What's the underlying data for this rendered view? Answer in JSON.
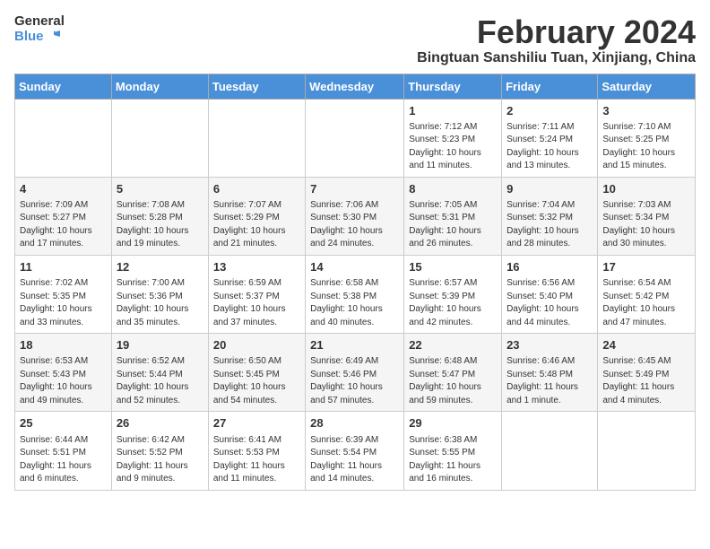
{
  "header": {
    "logo_text_general": "General",
    "logo_text_blue": "Blue",
    "month_year": "February 2024",
    "location": "Bingtuan Sanshiliu Tuan, Xinjiang, China"
  },
  "weekdays": [
    "Sunday",
    "Monday",
    "Tuesday",
    "Wednesday",
    "Thursday",
    "Friday",
    "Saturday"
  ],
  "weeks": [
    [
      {
        "day": "",
        "sunrise": "",
        "sunset": "",
        "daylight": "",
        "empty": true
      },
      {
        "day": "",
        "sunrise": "",
        "sunset": "",
        "daylight": "",
        "empty": true
      },
      {
        "day": "",
        "sunrise": "",
        "sunset": "",
        "daylight": "",
        "empty": true
      },
      {
        "day": "",
        "sunrise": "",
        "sunset": "",
        "daylight": "",
        "empty": true
      },
      {
        "day": "1",
        "sunrise": "Sunrise: 7:12 AM",
        "sunset": "Sunset: 5:23 PM",
        "daylight": "Daylight: 10 hours and 11 minutes.",
        "empty": false
      },
      {
        "day": "2",
        "sunrise": "Sunrise: 7:11 AM",
        "sunset": "Sunset: 5:24 PM",
        "daylight": "Daylight: 10 hours and 13 minutes.",
        "empty": false
      },
      {
        "day": "3",
        "sunrise": "Sunrise: 7:10 AM",
        "sunset": "Sunset: 5:25 PM",
        "daylight": "Daylight: 10 hours and 15 minutes.",
        "empty": false
      }
    ],
    [
      {
        "day": "4",
        "sunrise": "Sunrise: 7:09 AM",
        "sunset": "Sunset: 5:27 PM",
        "daylight": "Daylight: 10 hours and 17 minutes.",
        "empty": false
      },
      {
        "day": "5",
        "sunrise": "Sunrise: 7:08 AM",
        "sunset": "Sunset: 5:28 PM",
        "daylight": "Daylight: 10 hours and 19 minutes.",
        "empty": false
      },
      {
        "day": "6",
        "sunrise": "Sunrise: 7:07 AM",
        "sunset": "Sunset: 5:29 PM",
        "daylight": "Daylight: 10 hours and 21 minutes.",
        "empty": false
      },
      {
        "day": "7",
        "sunrise": "Sunrise: 7:06 AM",
        "sunset": "Sunset: 5:30 PM",
        "daylight": "Daylight: 10 hours and 24 minutes.",
        "empty": false
      },
      {
        "day": "8",
        "sunrise": "Sunrise: 7:05 AM",
        "sunset": "Sunset: 5:31 PM",
        "daylight": "Daylight: 10 hours and 26 minutes.",
        "empty": false
      },
      {
        "day": "9",
        "sunrise": "Sunrise: 7:04 AM",
        "sunset": "Sunset: 5:32 PM",
        "daylight": "Daylight: 10 hours and 28 minutes.",
        "empty": false
      },
      {
        "day": "10",
        "sunrise": "Sunrise: 7:03 AM",
        "sunset": "Sunset: 5:34 PM",
        "daylight": "Daylight: 10 hours and 30 minutes.",
        "empty": false
      }
    ],
    [
      {
        "day": "11",
        "sunrise": "Sunrise: 7:02 AM",
        "sunset": "Sunset: 5:35 PM",
        "daylight": "Daylight: 10 hours and 33 minutes.",
        "empty": false
      },
      {
        "day": "12",
        "sunrise": "Sunrise: 7:00 AM",
        "sunset": "Sunset: 5:36 PM",
        "daylight": "Daylight: 10 hours and 35 minutes.",
        "empty": false
      },
      {
        "day": "13",
        "sunrise": "Sunrise: 6:59 AM",
        "sunset": "Sunset: 5:37 PM",
        "daylight": "Daylight: 10 hours and 37 minutes.",
        "empty": false
      },
      {
        "day": "14",
        "sunrise": "Sunrise: 6:58 AM",
        "sunset": "Sunset: 5:38 PM",
        "daylight": "Daylight: 10 hours and 40 minutes.",
        "empty": false
      },
      {
        "day": "15",
        "sunrise": "Sunrise: 6:57 AM",
        "sunset": "Sunset: 5:39 PM",
        "daylight": "Daylight: 10 hours and 42 minutes.",
        "empty": false
      },
      {
        "day": "16",
        "sunrise": "Sunrise: 6:56 AM",
        "sunset": "Sunset: 5:40 PM",
        "daylight": "Daylight: 10 hours and 44 minutes.",
        "empty": false
      },
      {
        "day": "17",
        "sunrise": "Sunrise: 6:54 AM",
        "sunset": "Sunset: 5:42 PM",
        "daylight": "Daylight: 10 hours and 47 minutes.",
        "empty": false
      }
    ],
    [
      {
        "day": "18",
        "sunrise": "Sunrise: 6:53 AM",
        "sunset": "Sunset: 5:43 PM",
        "daylight": "Daylight: 10 hours and 49 minutes.",
        "empty": false
      },
      {
        "day": "19",
        "sunrise": "Sunrise: 6:52 AM",
        "sunset": "Sunset: 5:44 PM",
        "daylight": "Daylight: 10 hours and 52 minutes.",
        "empty": false
      },
      {
        "day": "20",
        "sunrise": "Sunrise: 6:50 AM",
        "sunset": "Sunset: 5:45 PM",
        "daylight": "Daylight: 10 hours and 54 minutes.",
        "empty": false
      },
      {
        "day": "21",
        "sunrise": "Sunrise: 6:49 AM",
        "sunset": "Sunset: 5:46 PM",
        "daylight": "Daylight: 10 hours and 57 minutes.",
        "empty": false
      },
      {
        "day": "22",
        "sunrise": "Sunrise: 6:48 AM",
        "sunset": "Sunset: 5:47 PM",
        "daylight": "Daylight: 10 hours and 59 minutes.",
        "empty": false
      },
      {
        "day": "23",
        "sunrise": "Sunrise: 6:46 AM",
        "sunset": "Sunset: 5:48 PM",
        "daylight": "Daylight: 11 hours and 1 minute.",
        "empty": false
      },
      {
        "day": "24",
        "sunrise": "Sunrise: 6:45 AM",
        "sunset": "Sunset: 5:49 PM",
        "daylight": "Daylight: 11 hours and 4 minutes.",
        "empty": false
      }
    ],
    [
      {
        "day": "25",
        "sunrise": "Sunrise: 6:44 AM",
        "sunset": "Sunset: 5:51 PM",
        "daylight": "Daylight: 11 hours and 6 minutes.",
        "empty": false
      },
      {
        "day": "26",
        "sunrise": "Sunrise: 6:42 AM",
        "sunset": "Sunset: 5:52 PM",
        "daylight": "Daylight: 11 hours and 9 minutes.",
        "empty": false
      },
      {
        "day": "27",
        "sunrise": "Sunrise: 6:41 AM",
        "sunset": "Sunset: 5:53 PM",
        "daylight": "Daylight: 11 hours and 11 minutes.",
        "empty": false
      },
      {
        "day": "28",
        "sunrise": "Sunrise: 6:39 AM",
        "sunset": "Sunset: 5:54 PM",
        "daylight": "Daylight: 11 hours and 14 minutes.",
        "empty": false
      },
      {
        "day": "29",
        "sunrise": "Sunrise: 6:38 AM",
        "sunset": "Sunset: 5:55 PM",
        "daylight": "Daylight: 11 hours and 16 minutes.",
        "empty": false
      },
      {
        "day": "",
        "sunrise": "",
        "sunset": "",
        "daylight": "",
        "empty": true
      },
      {
        "day": "",
        "sunrise": "",
        "sunset": "",
        "daylight": "",
        "empty": true
      }
    ]
  ]
}
